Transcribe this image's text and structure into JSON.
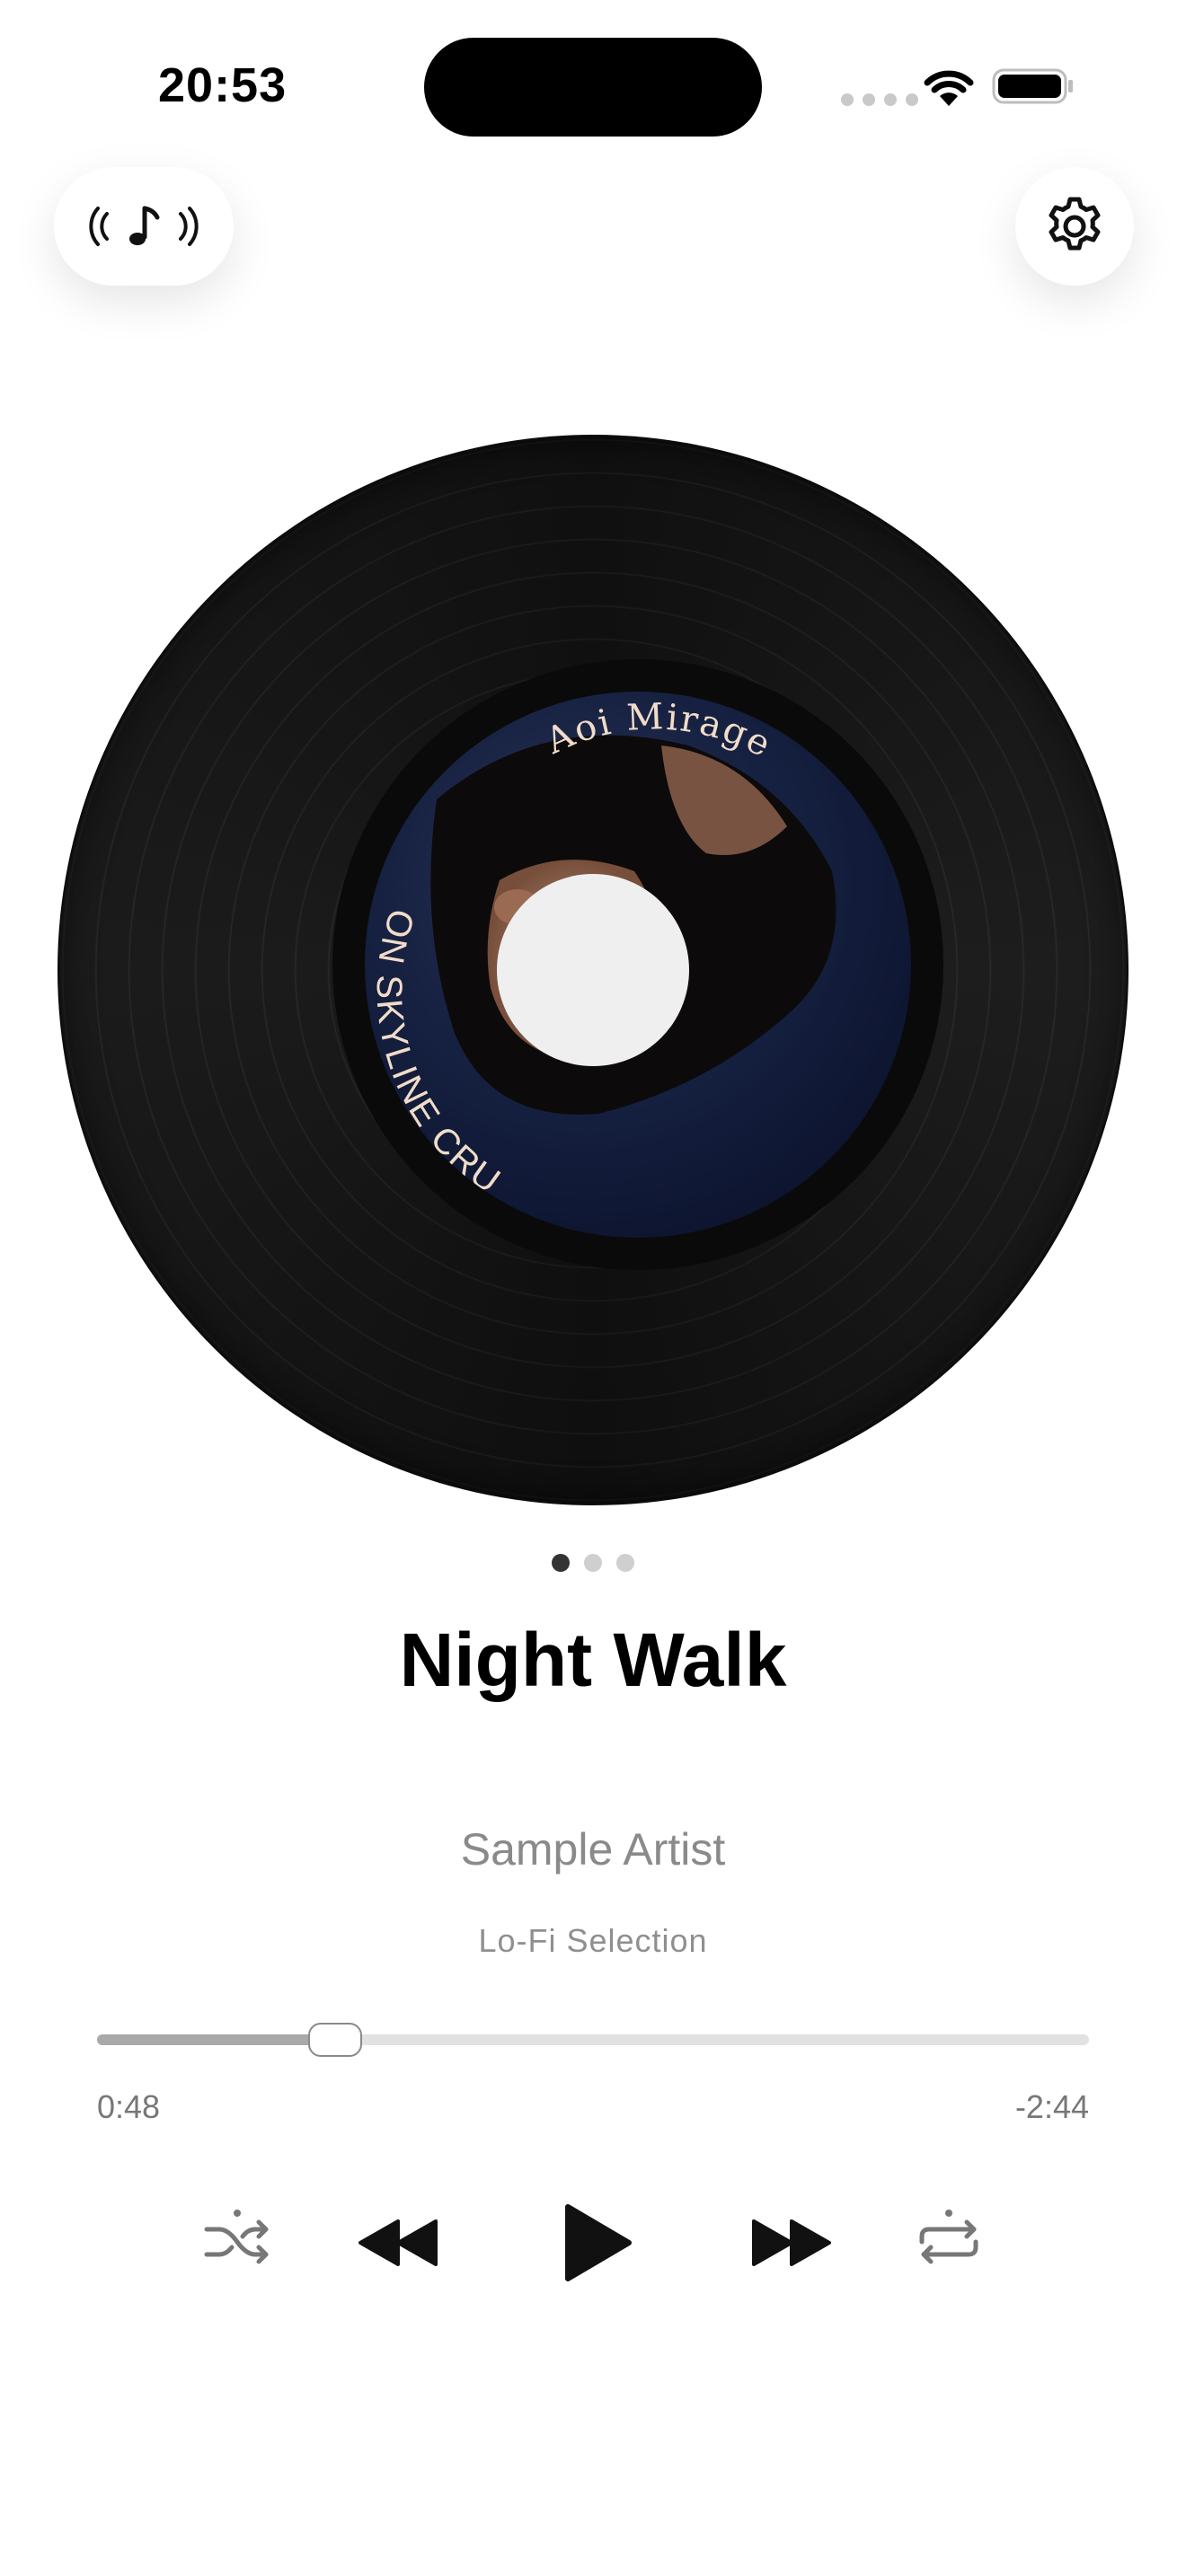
{
  "status_bar": {
    "time": "20:53",
    "wifi_icon": "wifi-icon",
    "battery_icon": "battery-full-icon"
  },
  "header": {
    "radio_icon": "radio-broadcast-music-icon",
    "settings_icon": "gear-icon"
  },
  "record": {
    "label_artist_text": "Aoi Mirage",
    "label_title_text": "ON SKYLINE CRU"
  },
  "pager": {
    "count": 3,
    "active_index": 0
  },
  "track": {
    "title": "Night Walk",
    "artist": "Sample Artist",
    "album": "Lo-Fi Selection"
  },
  "progress": {
    "elapsed": "0:48",
    "remaining": "-2:44",
    "fraction": 0.24
  },
  "controls": {
    "shuffle_icon": "shuffle-icon",
    "previous_icon": "rewind-icon",
    "play_icon": "play-icon",
    "next_icon": "fast-forward-icon",
    "repeat_icon": "repeat-icon"
  },
  "colors": {
    "vinyl": "#141414",
    "label_background": "#172243",
    "label_text": "#f1dcc9",
    "progress_fill": "#a9a9a9",
    "progress_track": "#e2e2e2",
    "secondary_text": "#8a8a8a"
  }
}
